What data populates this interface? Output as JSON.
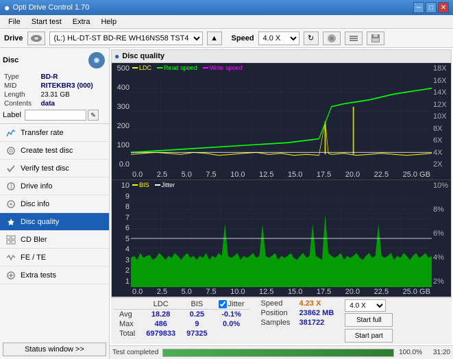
{
  "app": {
    "title": "Opti Drive Control 1.70",
    "icon": "●"
  },
  "titlebar": {
    "minimize": "─",
    "maximize": "□",
    "close": "✕"
  },
  "menubar": {
    "items": [
      "File",
      "Start test",
      "Extra",
      "Help"
    ]
  },
  "drivebar": {
    "drive_label": "Drive",
    "drive_value": "(L:)  HL-DT-ST BD-RE  WH16NS58 TST4",
    "speed_label": "Speed",
    "speed_value": "4.0 X"
  },
  "disc": {
    "title": "Disc",
    "type_label": "Type",
    "type_value": "BD-R",
    "mid_label": "MID",
    "mid_value": "RITEKBR3 (000)",
    "length_label": "Length",
    "length_value": "23.31 GB",
    "contents_label": "Contents",
    "contents_value": "data",
    "label_label": "Label",
    "label_value": ""
  },
  "nav": {
    "items": [
      {
        "id": "transfer-rate",
        "label": "Transfer rate",
        "icon": "📈"
      },
      {
        "id": "create-test-disc",
        "label": "Create test disc",
        "icon": "💿"
      },
      {
        "id": "verify-test-disc",
        "label": "Verify test disc",
        "icon": "✔"
      },
      {
        "id": "drive-info",
        "label": "Drive info",
        "icon": "ℹ"
      },
      {
        "id": "disc-info",
        "label": "Disc info",
        "icon": "📀"
      },
      {
        "id": "disc-quality",
        "label": "Disc quality",
        "icon": "★",
        "active": true
      },
      {
        "id": "cd-bler",
        "label": "CD Bler",
        "icon": "▦"
      },
      {
        "id": "fe-te",
        "label": "FE / TE",
        "icon": "〰"
      },
      {
        "id": "extra-tests",
        "label": "Extra tests",
        "icon": "🔧"
      }
    ],
    "status_btn": "Status window >>"
  },
  "chart": {
    "title": "Disc quality",
    "upper": {
      "legend": [
        {
          "label": "LDC",
          "color": "#ffff00"
        },
        {
          "label": "Read speed",
          "color": "#00ff00"
        },
        {
          "label": "Write speed",
          "color": "#ff00ff"
        }
      ],
      "y_axis_left": [
        "500",
        "400",
        "300",
        "200",
        "100",
        "0.0"
      ],
      "y_axis_right": [
        "18X",
        "16X",
        "14X",
        "12X",
        "10X",
        "8X",
        "6X",
        "4X",
        "2X"
      ],
      "x_axis": [
        "0.0",
        "2.5",
        "5.0",
        "7.5",
        "10.0",
        "12.5",
        "15.0",
        "17.5",
        "20.0",
        "22.5",
        "25.0 GB"
      ]
    },
    "lower": {
      "legend": [
        {
          "label": "BIS",
          "color": "#ffff00"
        },
        {
          "label": "Jitter",
          "color": "#ffffff"
        }
      ],
      "y_axis_left": [
        "10",
        "9",
        "8",
        "7",
        "6",
        "5",
        "4",
        "3",
        "2",
        "1"
      ],
      "y_axis_right": [
        "10%",
        "8%",
        "6%",
        "4%",
        "2%"
      ],
      "x_axis": [
        "0.0",
        "2.5",
        "5.0",
        "7.5",
        "10.0",
        "12.5",
        "15.0",
        "17.5",
        "20.0",
        "22.5",
        "25.0 GB"
      ]
    }
  },
  "stats": {
    "headers": [
      "LDC",
      "BIS",
      "",
      "Jitter",
      "Speed",
      ""
    ],
    "rows": [
      {
        "label": "Avg",
        "ldc": "18.28",
        "bis": "0.25",
        "jitter": "-0.1%",
        "speed_label": "Position",
        "speed_val": "23862 MB"
      },
      {
        "label": "Max",
        "ldc": "486",
        "bis": "9",
        "jitter": "0.0%",
        "speed_label": "Samples",
        "speed_val": "381722"
      },
      {
        "label": "Total",
        "ldc": "6979833",
        "bis": "97325",
        "jitter": ""
      }
    ],
    "jitter_checked": true,
    "jitter_label": "Jitter",
    "speed_display": "4.23 X",
    "speed_unit": "4.0 X",
    "btn_start_full": "Start full",
    "btn_start_part": "Start part"
  },
  "progress": {
    "status_text": "Test completed",
    "percent": 100.0,
    "percent_display": "100.0%",
    "time": "31:20"
  }
}
